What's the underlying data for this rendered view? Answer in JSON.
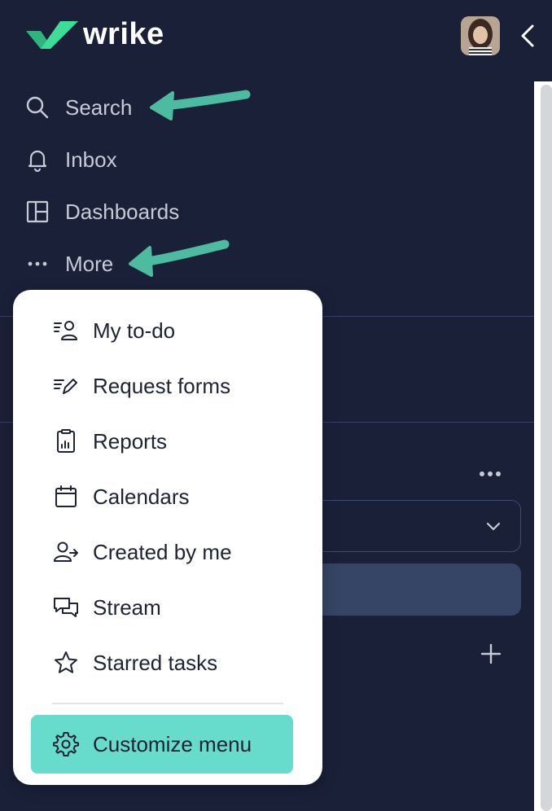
{
  "brand": {
    "name": "wrike",
    "mark_color": "#3ddc97"
  },
  "header": {
    "avatar_alt": "User avatar",
    "collapse_icon": "chevron-left-icon"
  },
  "nav": {
    "items": [
      {
        "label": "Search",
        "icon": "search-icon"
      },
      {
        "label": "Inbox",
        "icon": "bell-icon"
      },
      {
        "label": "Dashboards",
        "icon": "dashboard-icon"
      },
      {
        "label": "More",
        "icon": "more-dots-icon"
      }
    ]
  },
  "more_menu": {
    "items": [
      {
        "label": "My to-do",
        "icon": "my-todo-icon"
      },
      {
        "label": "Request forms",
        "icon": "request-forms-icon"
      },
      {
        "label": "Reports",
        "icon": "reports-icon"
      },
      {
        "label": "Calendars",
        "icon": "calendar-icon"
      },
      {
        "label": "Created by me",
        "icon": "created-by-me-icon"
      },
      {
        "label": "Stream",
        "icon": "stream-icon"
      },
      {
        "label": "Starred tasks",
        "icon": "star-icon"
      }
    ],
    "customize_label": "Customize menu",
    "customize_icon": "gear-icon",
    "customize_color": "#67dccd"
  },
  "colors": {
    "background": "#1a2038",
    "nav_text": "#c6cbd8",
    "annotation_arrow": "#4dbb9f"
  }
}
